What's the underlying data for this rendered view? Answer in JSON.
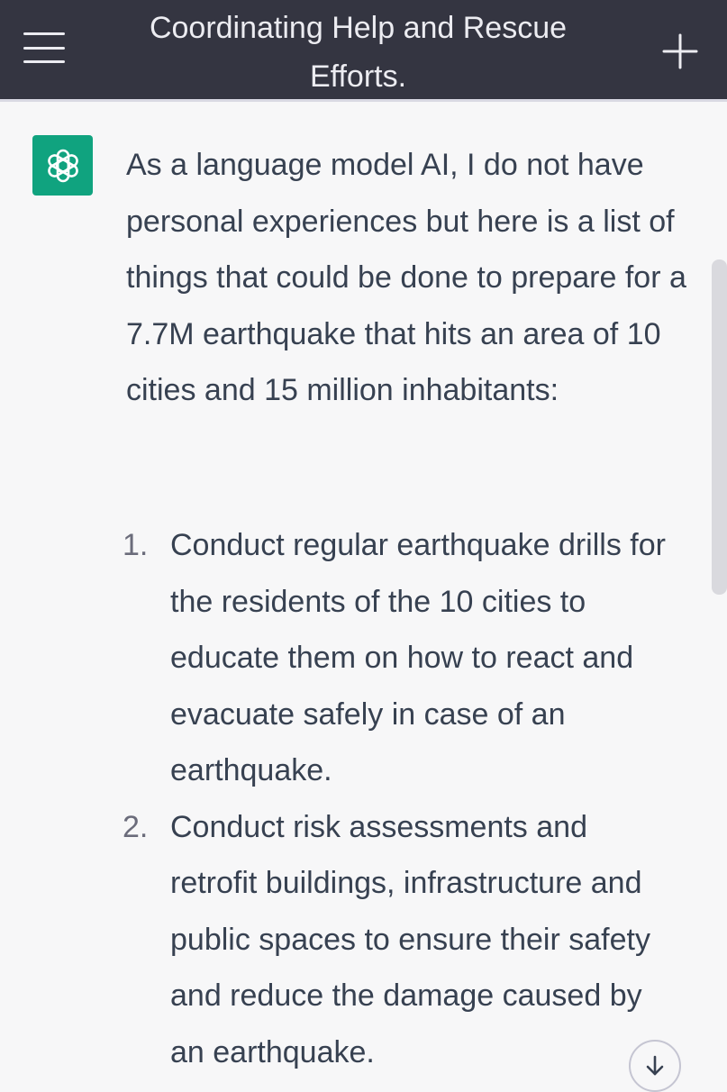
{
  "header": {
    "title": "Coordinating Help and Rescue Efforts.",
    "menu_icon": "hamburger-menu-icon",
    "new_chat_icon": "plus-icon"
  },
  "assistant": {
    "avatar_icon": "openai-logo-icon",
    "avatar_color": "#10a37f",
    "intro": "As a language model AI, I do not have personal experiences but here is a list of things that could be done to prepare for a 7.7M earthquake that hits an area of 10 cities and 15 million inhabitants:",
    "items": [
      {
        "number": "1.",
        "text": "Conduct regular earthquake drills for the residents of the 10 cities to educate them on how to react and evacuate safely in case of an earthquake."
      },
      {
        "number": "2.",
        "text": "Conduct risk assessments and retrofit buildings, infrastructure and public spaces to ensure their safety and reduce the damage caused by an earthquake."
      }
    ]
  },
  "scroll_down_icon": "arrow-down-icon",
  "colors": {
    "header_bg": "#343541",
    "page_bg": "#f7f7f8",
    "text": "#374151"
  }
}
